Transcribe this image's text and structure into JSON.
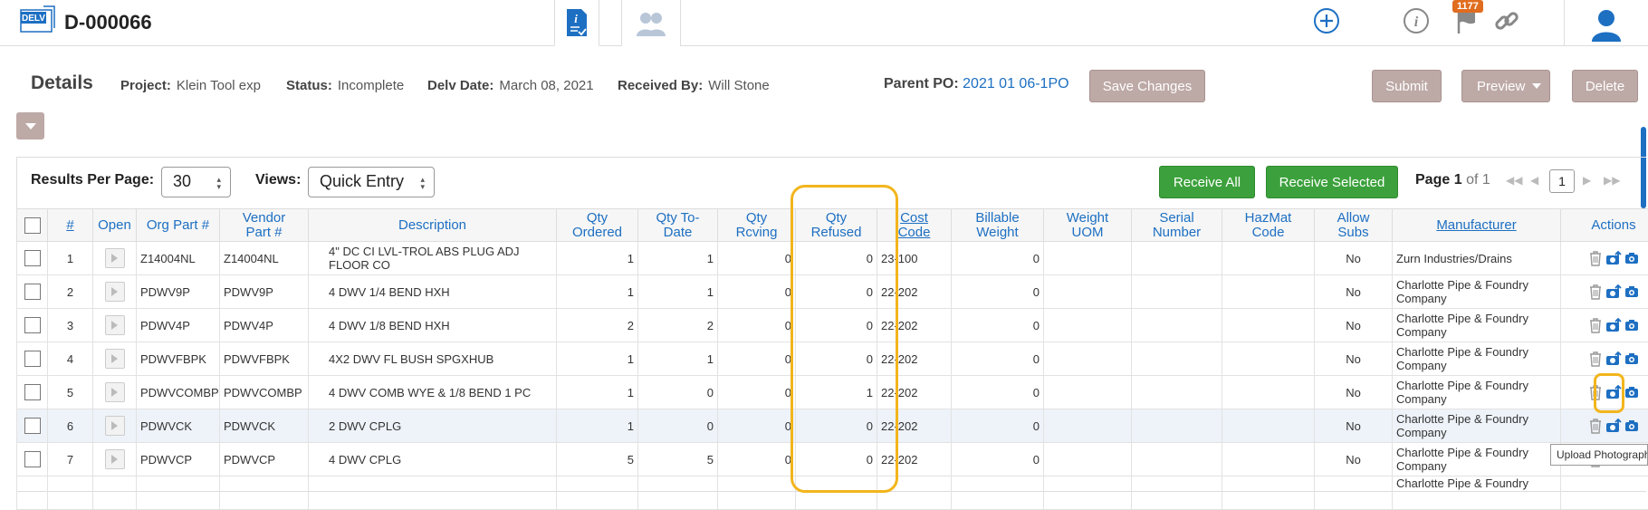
{
  "header": {
    "logo_text": "DELV",
    "doc_id": "D-000066",
    "notification_count": "1177"
  },
  "details": {
    "title": "Details",
    "project_label": "Project:",
    "project_value": "Klein Tool exp",
    "status_label": "Status:",
    "status_value": "Incomplete",
    "date_label": "Delv Date:",
    "date_value": "March 08, 2021",
    "received_label": "Received By:",
    "received_value": "Will Stone",
    "parent_po_label": "Parent PO:",
    "parent_po_value": "2021 01 06-1PO",
    "save_changes": "Save Changes",
    "submit": "Submit",
    "preview": "Preview",
    "delete": "Delete"
  },
  "controls": {
    "results_label": "Results Per Page:",
    "results_value": "30",
    "views_label": "Views:",
    "views_value": "Quick Entry",
    "receive_all": "Receive All",
    "receive_selected": "Receive Selected",
    "page_label": "Page",
    "page_current": "1",
    "page_of": "of 1",
    "page_input": "1"
  },
  "table": {
    "headers": {
      "num": "#",
      "open": "Open",
      "org_part": "Org Part #",
      "vendor_part_1": "Vendor",
      "vendor_part_2": "Part #",
      "description": "Description",
      "qty_ordered_1": "Qty",
      "qty_ordered_2": "Ordered",
      "qty_todate_1": "Qty To-",
      "qty_todate_2": "Date",
      "qty_rcving_1": "Qty",
      "qty_rcving_2": "Rcving",
      "qty_refused_1": "Qty",
      "qty_refused_2": "Refused",
      "cost_code_1": "Cost",
      "cost_code_2": "Code",
      "billable_1": "Billable",
      "billable_2": "Weight",
      "weight_uom_1": "Weight",
      "weight_uom_2": "UOM",
      "serial_1": "Serial",
      "serial_2": "Number",
      "hazmat_1": "HazMat",
      "hazmat_2": "Code",
      "allow_subs_1": "Allow",
      "allow_subs_2": "Subs",
      "manufacturer": "Manufacturer",
      "actions": "Actions"
    },
    "rows": [
      {
        "num": "1",
        "org": "Z14004NL",
        "vendor": "Z14004NL",
        "desc": "4\" DC CI LVL-TROL ABS PLUG ADJ FLOOR CO",
        "ordered": "1",
        "todate": "1",
        "rcving": "0",
        "refused": "0",
        "cost": "23-100",
        "billable": "0",
        "subs": "No",
        "mfr": "Zurn Industries/Drains"
      },
      {
        "num": "2",
        "org": "PDWV9P",
        "vendor": "PDWV9P",
        "desc": "4 DWV 1/4 BEND HXH",
        "ordered": "1",
        "todate": "1",
        "rcving": "0",
        "refused": "0",
        "cost": "22-202",
        "billable": "0",
        "subs": "No",
        "mfr": "Charlotte Pipe & Foundry Company"
      },
      {
        "num": "3",
        "org": "PDWV4P",
        "vendor": "PDWV4P",
        "desc": "4 DWV 1/8 BEND HXH",
        "ordered": "2",
        "todate": "2",
        "rcving": "0",
        "refused": "0",
        "cost": "22-202",
        "billable": "0",
        "subs": "No",
        "mfr": "Charlotte Pipe & Foundry Company"
      },
      {
        "num": "4",
        "org": "PDWVFBPK",
        "vendor": "PDWVFBPK",
        "desc": "4X2 DWV FL BUSH SPGXHUB",
        "ordered": "1",
        "todate": "1",
        "rcving": "0",
        "refused": "0",
        "cost": "22-202",
        "billable": "0",
        "subs": "No",
        "mfr": "Charlotte Pipe & Foundry Company"
      },
      {
        "num": "5",
        "org": "PDWVCOMBP",
        "vendor": "PDWVCOMBP",
        "desc": "4 DWV COMB WYE & 1/8 BEND 1 PC",
        "ordered": "1",
        "todate": "0",
        "rcving": "0",
        "refused": "1",
        "cost": "22-202",
        "billable": "0",
        "subs": "No",
        "mfr": "Charlotte Pipe & Foundry Company"
      },
      {
        "num": "6",
        "org": "PDWVCK",
        "vendor": "PDWVCK",
        "desc": "2 DWV CPLG",
        "ordered": "1",
        "todate": "0",
        "rcving": "0",
        "refused": "0",
        "cost": "22-202",
        "billable": "0",
        "subs": "No",
        "mfr": "Charlotte Pipe & Foundry Company"
      },
      {
        "num": "7",
        "org": "PDWVCP",
        "vendor": "PDWVCP",
        "desc": "4 DWV CPLG",
        "ordered": "5",
        "todate": "5",
        "rcving": "0",
        "refused": "0",
        "cost": "22-202",
        "billable": "0",
        "subs": "No",
        "mfr": "Charlotte Pipe & Foundry Company"
      }
    ],
    "partial_row_mfr": "Charlotte Pipe & Foundry"
  },
  "tooltip": "Upload Photograph"
}
